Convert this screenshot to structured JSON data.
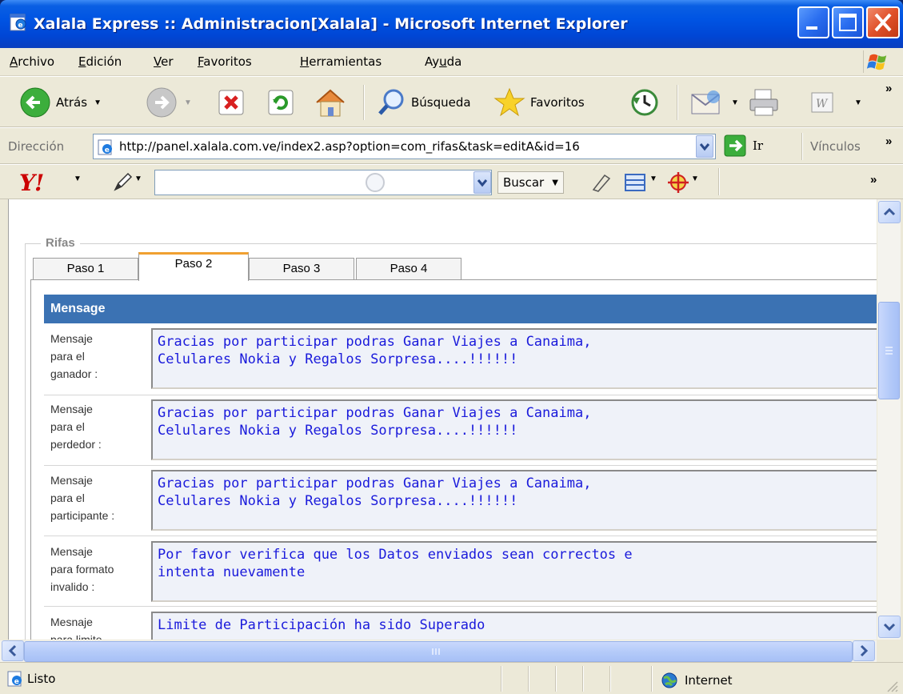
{
  "window": {
    "title": "Xalala Express :: Administracion[Xalala] - Microsoft Internet Explorer"
  },
  "menu": {
    "items": [
      {
        "label": "Archivo",
        "mnemonic": "A"
      },
      {
        "label": "Edición",
        "mnemonic": "E"
      },
      {
        "label": "Ver",
        "mnemonic": "V"
      },
      {
        "label": "Favoritos",
        "mnemonic": "F"
      },
      {
        "label": "Herramientas",
        "mnemonic": "H"
      },
      {
        "label": "Ayuda",
        "mnemonic": "u"
      }
    ]
  },
  "toolbar": {
    "back_label": "Atrás",
    "search_label": "Búsqueda",
    "favorites_label": "Favoritos"
  },
  "address": {
    "label": "Dirección",
    "url": "http://panel.xalala.com.ve/index2.asp?option=com_rifas&task=editA&id=16",
    "go_label": "Ir",
    "links_label": "Vínculos"
  },
  "yahoo": {
    "logo": "Y!",
    "search_label": "Buscar",
    "search_value": ""
  },
  "content": {
    "fieldset_legend": "Rifas",
    "tabs": [
      {
        "label": "Paso 1",
        "active": false
      },
      {
        "label": "Paso 2",
        "active": true
      },
      {
        "label": "Paso 3",
        "active": false
      },
      {
        "label": "Paso 4",
        "active": false
      }
    ],
    "section_title": "Mensage",
    "rows": [
      {
        "label": "Mensaje\npara el\nganador :",
        "value": "Gracias por participar podras Ganar Viajes a Canaima,\nCelulares Nokia y Regalos Sorpresa....!!!!!!"
      },
      {
        "label": "Mensaje\npara el\nperdedor :",
        "value": "Gracias por participar podras Ganar Viajes a Canaima,\nCelulares Nokia y Regalos Sorpresa....!!!!!!"
      },
      {
        "label": "Mensaje\npara el\nparticipante :",
        "value": "Gracias por participar podras Ganar Viajes a Canaima,\nCelulares Nokia y Regalos Sorpresa....!!!!!!"
      },
      {
        "label": "Mensaje\npara formato\ninvalido :",
        "value": "Por favor verifica que los Datos enviados sean correctos e\nintenta nuevamente"
      },
      {
        "label": "Mesnaje\npara limite",
        "value": "Limite de Participación ha sido Superado"
      }
    ]
  },
  "status": {
    "text": "Listo",
    "zone": "Internet"
  },
  "colors": {
    "titlebar": "#0054e3",
    "section_header": "#3b72b3",
    "message_text": "#1a1adb",
    "message_bg": "#eff2f9",
    "active_tab_accent": "#f0a030"
  }
}
